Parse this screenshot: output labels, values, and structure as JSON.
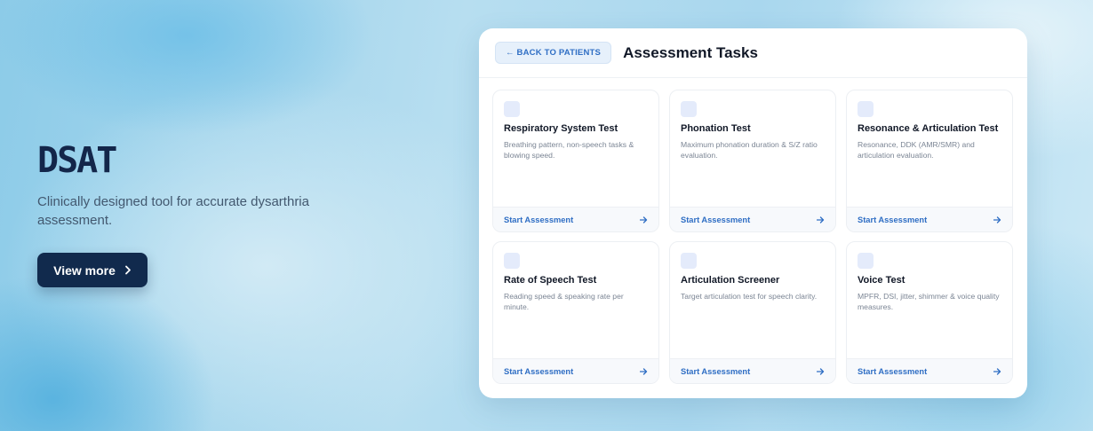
{
  "hero": {
    "title": "DSAT",
    "subtitle": "Clinically designed tool for accurate dysarthria assessment.",
    "button_label": "View more",
    "button_icon": "chevron-right-icon"
  },
  "panel": {
    "back_label": "← BACK TO PATIENTS",
    "title": "Assessment Tasks"
  },
  "cards": [
    {
      "title": "Respiratory System Test",
      "description": "Breathing pattern, non-speech tasks & blowing speed.",
      "cta": "Start Assessment",
      "icon": "arrow-right-icon"
    },
    {
      "title": "Phonation Test",
      "description": "Maximum phonation duration & S/Z ratio evaluation.",
      "cta": "Start Assessment",
      "icon": "arrow-right-icon"
    },
    {
      "title": "Resonance & Articulation Test",
      "description": "Resonance, DDK (AMR/SMR) and articulation evaluation.",
      "cta": "Start Assessment",
      "icon": "arrow-right-icon"
    },
    {
      "title": "Rate of Speech Test",
      "description": "Reading speed & speaking rate per minute.",
      "cta": "Start Assessment",
      "icon": "arrow-right-icon"
    },
    {
      "title": "Articulation Screener",
      "description": "Target articulation test for speech clarity.",
      "cta": "Start Assessment",
      "icon": "arrow-right-icon"
    },
    {
      "title": "Voice Test",
      "description": "MPFR, DSI, jitter, shimmer & voice quality measures.",
      "cta": "Start Assessment",
      "icon": "arrow-right-icon"
    }
  ],
  "colors": {
    "accent": "#2f6ec4",
    "dark_navy": "#112a4d",
    "title_navy": "#13264a",
    "icon_tile": "#e4ebfb"
  }
}
